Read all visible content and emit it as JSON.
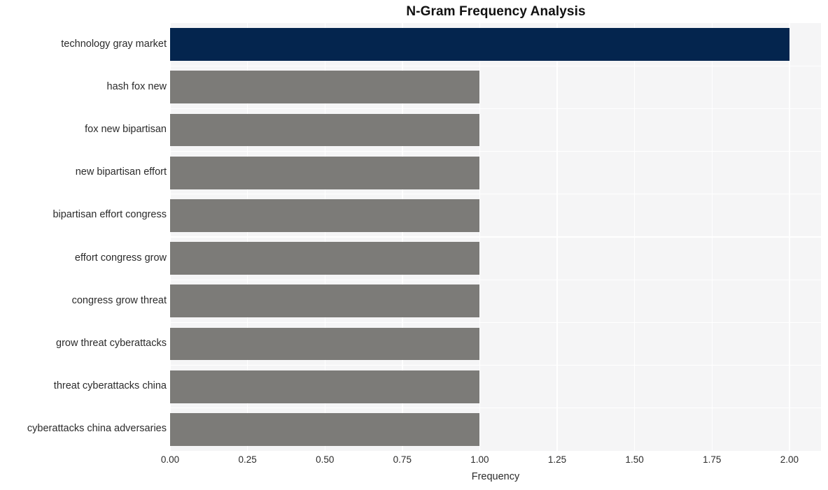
{
  "chart_data": {
    "type": "bar",
    "orientation": "horizontal",
    "title": "N-Gram Frequency Analysis",
    "xlabel": "Frequency",
    "ylabel": "",
    "categories": [
      "technology gray market",
      "hash fox new",
      "fox new bipartisan",
      "new bipartisan effort",
      "bipartisan effort congress",
      "effort congress grow",
      "congress grow threat",
      "grow threat cyberattacks",
      "threat cyberattacks china",
      "cyberattacks china adversaries"
    ],
    "values": [
      2,
      1,
      1,
      1,
      1,
      1,
      1,
      1,
      1,
      1
    ],
    "bar_colors": [
      "#04254e",
      "#7c7b78",
      "#7c7b78",
      "#7c7b78",
      "#7c7b78",
      "#7c7b78",
      "#7c7b78",
      "#7c7b78",
      "#7c7b78",
      "#7c7b78"
    ],
    "xlim": [
      0,
      2.102
    ],
    "xticks": [
      0,
      0.25,
      0.5,
      0.75,
      1.0,
      1.25,
      1.5,
      1.75,
      2.0
    ],
    "xtick_labels": [
      "0.00",
      "0.25",
      "0.50",
      "0.75",
      "1.00",
      "1.25",
      "1.50",
      "1.75",
      "2.00"
    ],
    "grid": true,
    "legend": "none",
    "plot_background": "#f5f5f6",
    "gridline_color": "#ffffff",
    "figure_background": "#ffffff",
    "accent_color": "#04254e",
    "secondary_color": "#7c7b78"
  }
}
